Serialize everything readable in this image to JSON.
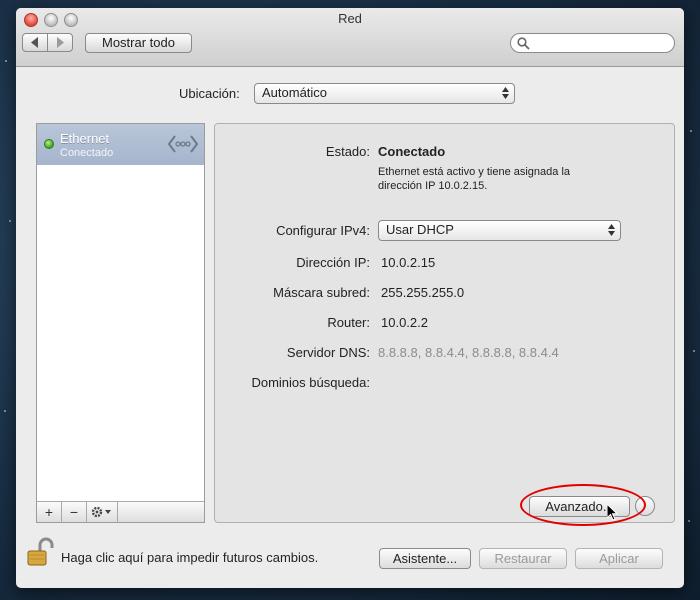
{
  "window": {
    "title": "Red"
  },
  "toolbar": {
    "show_all_label": "Mostrar todo",
    "search_placeholder": ""
  },
  "location": {
    "label": "Ubicación:",
    "value": "Automático"
  },
  "sidebar": {
    "items": [
      {
        "name": "Ethernet",
        "status": "Conectado",
        "status_color": "#3aa41c"
      }
    ],
    "toolbar": {
      "add": "+",
      "remove": "−"
    }
  },
  "details": {
    "status": {
      "label": "Estado:",
      "value": "Conectado"
    },
    "description_line1": "Ethernet está activo y tiene asignada la",
    "description_line2": "dirección IP 10.0.2.15.",
    "configure_ipv4": {
      "label": "Configurar IPv4:",
      "value": "Usar DHCP"
    },
    "ip_address": {
      "label": "Dirección IP:",
      "value": "10.0.2.15"
    },
    "subnet_mask": {
      "label": "Máscara subred:",
      "value": "255.255.255.0"
    },
    "router": {
      "label": "Router:",
      "value": "10.0.2.2"
    },
    "dns": {
      "label": "Servidor DNS:",
      "value": "8.8.8.8, 8.8.4.4, 8.8.8.8, 8.8.4.4"
    },
    "search_domains": {
      "label": "Dominios búsqueda:",
      "value": ""
    },
    "advanced_label": "Avanzado...",
    "help_label": "?"
  },
  "footer": {
    "lock_text": "Haga clic aquí para impedir futuros cambios.",
    "assistant_label": "Asistente...",
    "revert_label": "Restaurar",
    "apply_label": "Aplicar"
  },
  "colors": {
    "selection": "#a5b5cc",
    "highlight_ring": "#e00000"
  }
}
